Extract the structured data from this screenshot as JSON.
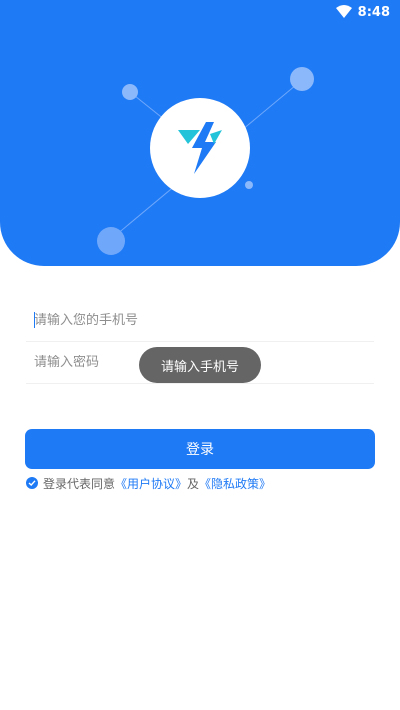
{
  "status_bar": {
    "time": "8:48",
    "wifi_icon": "wifi-icon"
  },
  "header": {
    "logo_icon": "lightning-logo-icon",
    "brand_color": "#1f7af5"
  },
  "form": {
    "phone_placeholder": "请输入您的手机号",
    "password_placeholder": "请输入密码",
    "login_label": "登录"
  },
  "toast": {
    "message": "请输入手机号"
  },
  "agreement": {
    "prefix": "登录代表同意",
    "user_agreement": "《用户协议》",
    "and": "及",
    "privacy_policy": "《隐私政策》",
    "checked": true
  }
}
